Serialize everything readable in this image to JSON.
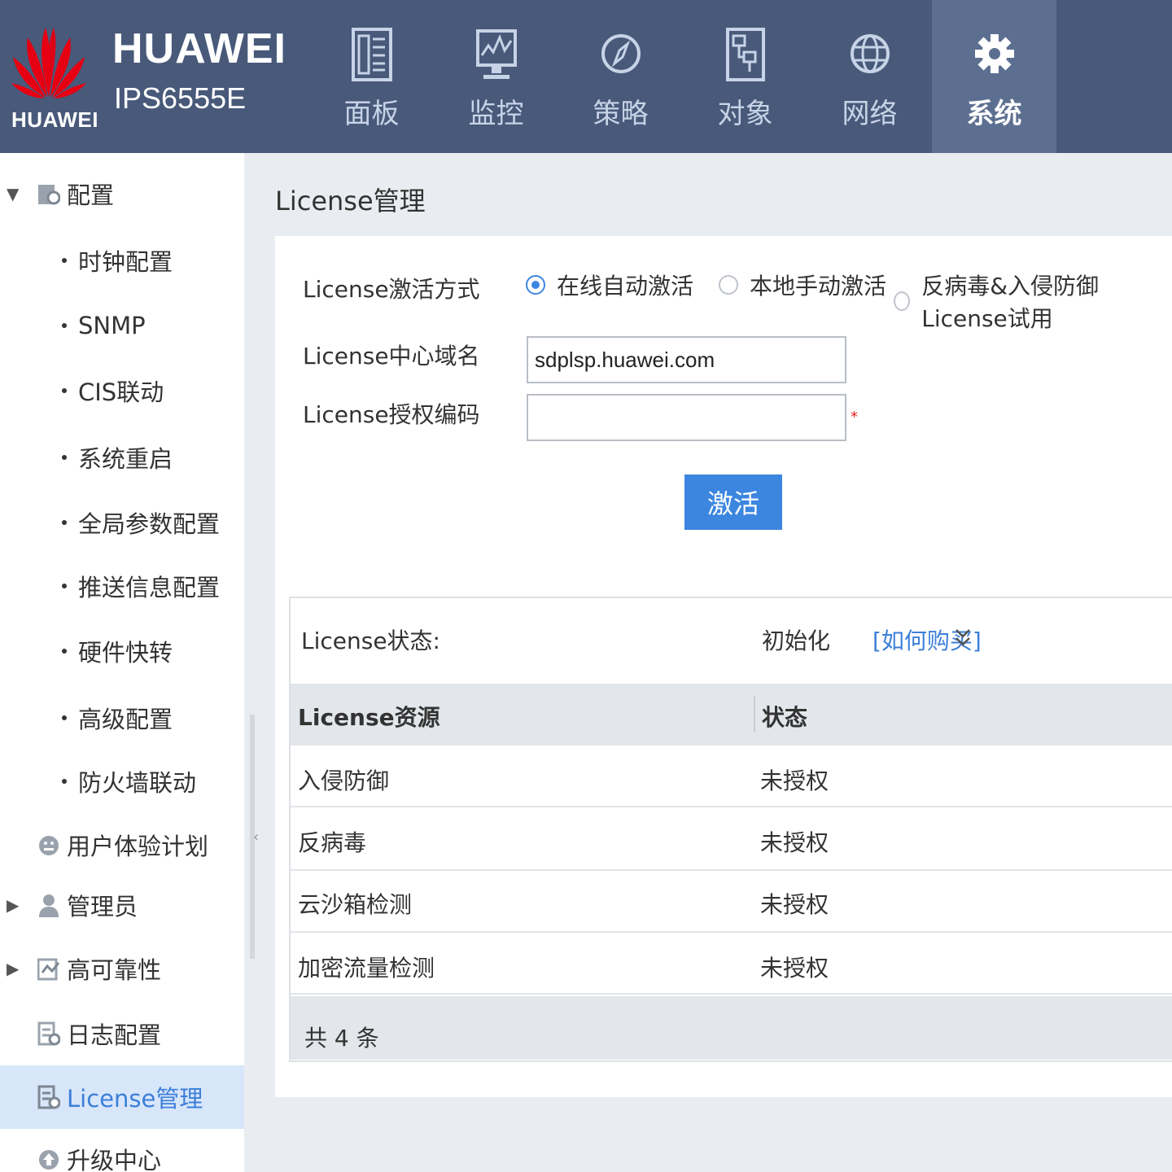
{
  "brand": {
    "logo_text": "HUAWEI",
    "title": "HUAWEI",
    "model": "IPS6555E",
    "color": "#e60012"
  },
  "nav": {
    "items": [
      {
        "label": "面板",
        "icon": "dashboard-icon"
      },
      {
        "label": "监控",
        "icon": "monitor-icon"
      },
      {
        "label": "策略",
        "icon": "compass-icon"
      },
      {
        "label": "对象",
        "icon": "object-icon"
      },
      {
        "label": "网络",
        "icon": "globe-icon"
      },
      {
        "label": "系统",
        "icon": "gear-icon",
        "active": true
      }
    ]
  },
  "sidebar": {
    "items": [
      {
        "label": "配置",
        "expanded": true
      },
      {
        "label": "时钟配置"
      },
      {
        "label": "SNMP"
      },
      {
        "label": "CIS联动"
      },
      {
        "label": "系统重启"
      },
      {
        "label": "全局参数配置"
      },
      {
        "label": "推送信息配置"
      },
      {
        "label": "硬件快转"
      },
      {
        "label": "高级配置"
      },
      {
        "label": "防火墙联动"
      },
      {
        "label": "用户体验计划"
      },
      {
        "label": "管理员"
      },
      {
        "label": "高可靠性"
      },
      {
        "label": "日志配置"
      },
      {
        "label": "License管理",
        "active": true
      },
      {
        "label": "升级中心"
      }
    ]
  },
  "page": {
    "title": "License管理"
  },
  "form": {
    "activation_label": "License激活方式",
    "options": [
      "在线自动激活",
      "本地手动激活",
      "反病毒&入侵防御License试用"
    ],
    "selected": "在线自动激活",
    "domain_label": "License中心域名",
    "domain_value": "sdplsp.huawei.com",
    "code_label": "License授权编码",
    "code_value": "",
    "required_mark": "*",
    "activate_button": "激活"
  },
  "status": {
    "label": "License状态:",
    "value": "初始化",
    "buy_link": "[如何购买]"
  },
  "table": {
    "headers": [
      "License资源",
      "状态"
    ],
    "rows": [
      [
        "入侵防御",
        "未授权"
      ],
      [
        "反病毒",
        "未授权"
      ],
      [
        "云沙箱检测",
        "未授权"
      ],
      [
        "加密流量检测",
        "未授权"
      ]
    ],
    "total": "共 4 条"
  },
  "colors": {
    "topbar": "#48597a",
    "accent": "#3c86e0",
    "sidebar_active": "#d8e6fa"
  }
}
